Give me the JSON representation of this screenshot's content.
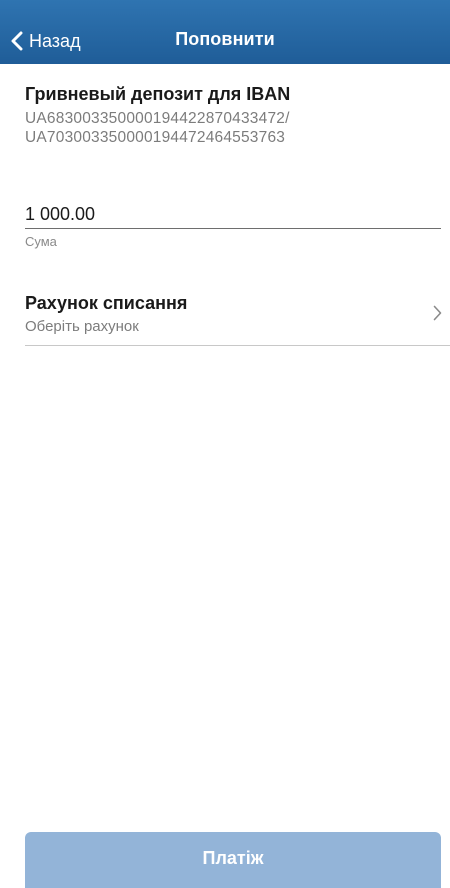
{
  "navbar": {
    "back_label": "Назад",
    "title": "Поповнити",
    "background_color": "#2469a8"
  },
  "deposit": {
    "title": "Гривневый депозит для IBAN",
    "iban_lines": [
      "UA683003350000194422870433472/",
      "UA703003350000194472464553763"
    ]
  },
  "amount": {
    "value": "1 000.00",
    "caption": "Сума"
  },
  "account": {
    "title": "Рахунок списання",
    "hint": "Оберіть рахунок",
    "chevron_icon": "chevron-right-icon"
  },
  "pay": {
    "label": "Платіж",
    "color": "#93b4d8",
    "enabled": false
  }
}
